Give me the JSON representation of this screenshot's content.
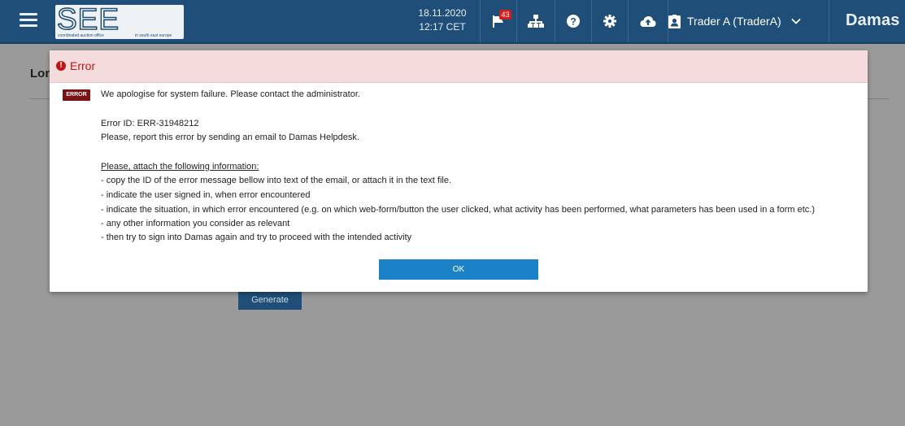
{
  "header": {
    "logo": {
      "text": "SEE CAO",
      "tagline_left": "coordinated auction office",
      "tagline_right": "in south east europe"
    },
    "date": "18.11.2020",
    "time": "12:17 CET",
    "notifications_count": "43",
    "user_label": "Trader A (TraderA)",
    "brand": "Damas",
    "icons": [
      "menu-icon",
      "flag-icon",
      "sitemap-icon",
      "help-icon",
      "settings-icon",
      "cloud-upload-icon",
      "user-badge-icon",
      "chevron-down-icon"
    ]
  },
  "page": {
    "heading": "Long",
    "generate_label": "Generate"
  },
  "dialog": {
    "title": "Error",
    "tag": "ERROR",
    "lines": [
      "We apologise for system failure. Please contact the administrator.",
      "Error ID: ERR-31948212",
      "Please, report this error by sending an email to Damas Helpdesk.",
      "Please, attach the following information:",
      "- copy the ID of the error message bellow into text of the email, or attach it in the text file.",
      "- indicate the user signed in, when error encountered",
      "- indicate the situation, in which error encountered (e.g. on which web-form/button the user clicked, what activity has been performed, what parameters has been used in a form etc.)",
      "- any other information you consider as relevant",
      "- then try to sign into Damas again and try to proceed with the intended activity"
    ],
    "ok_label": "OK"
  },
  "colors": {
    "header_bg": "#1f4f78",
    "overlay_bg": "#9a9a9a",
    "dialog_header_bg": "#f5dcdc",
    "error_red": "#c01515",
    "error_tag_bg": "#7a1313",
    "ok_button_bg": "#1c82c8",
    "notification_badge": "#d41e1e"
  }
}
